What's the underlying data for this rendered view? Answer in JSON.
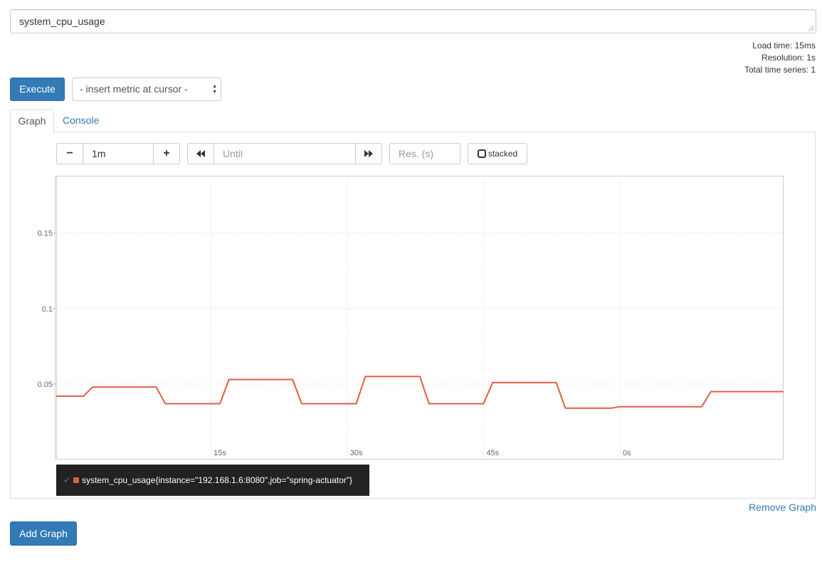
{
  "expression": {
    "value": "system_cpu_usage"
  },
  "stats": {
    "load_time": "Load time: 15ms",
    "resolution": "Resolution: 1s",
    "total_series": "Total time series: 1"
  },
  "toolbar": {
    "execute_label": "Execute",
    "metric_select": "- insert metric at cursor -"
  },
  "tabs": [
    {
      "label": "Graph",
      "active": true
    },
    {
      "label": "Console",
      "active": false
    }
  ],
  "graph_controls": {
    "range_minus": "−",
    "range_value": "1m",
    "range_plus": "+",
    "back_icon": "double-left-arrow-icon",
    "until_placeholder": "Until",
    "forward_icon": "double-right-arrow-icon",
    "resolution_placeholder": "Res. (s)",
    "stacked_label": "stacked"
  },
  "chart_data": {
    "type": "line",
    "ylim": [
      0.0,
      0.188
    ],
    "y_ticks": [
      {
        "value": 0.05,
        "label": "0.05"
      },
      {
        "value": 0.1,
        "label": "0.1"
      },
      {
        "value": 0.15,
        "label": "0.15"
      }
    ],
    "x_range": [
      -62,
      18
    ],
    "x_ticks": [
      {
        "value": -45,
        "label": "15s"
      },
      {
        "value": -30,
        "label": "30s"
      },
      {
        "value": -15,
        "label": "45s"
      },
      {
        "value": 0,
        "label": "0s"
      }
    ],
    "grid": true,
    "series": [
      {
        "name": "system_cpu_usage{instance=\"192.168.1.6:8080\",job=\"spring-actuator\"}",
        "color": "#e05d44",
        "x": [
          -62,
          -60,
          -59,
          -58,
          -55,
          -54,
          -51,
          -50,
          -47,
          -46,
          -44,
          -43,
          -40,
          -39,
          -36,
          -35,
          -33,
          -32,
          -29,
          -28,
          -26,
          -25,
          -22,
          -21,
          -19,
          -18,
          -15,
          -14,
          -11,
          -10,
          -7,
          -6,
          -5,
          -4,
          -1,
          0,
          4,
          5,
          9,
          10,
          16,
          18
        ],
        "y": [
          0.042,
          0.042,
          0.042,
          0.048,
          0.048,
          0.048,
          0.048,
          0.037,
          0.037,
          0.037,
          0.037,
          0.053,
          0.053,
          0.053,
          0.053,
          0.037,
          0.037,
          0.037,
          0.037,
          0.055,
          0.055,
          0.055,
          0.055,
          0.037,
          0.037,
          0.037,
          0.037,
          0.051,
          0.051,
          0.051,
          0.051,
          0.034,
          0.034,
          0.034,
          0.034,
          0.035,
          0.035,
          0.035,
          0.035,
          0.045,
          0.045,
          0.045
        ]
      }
    ]
  },
  "legend": {
    "check_icon": "check-icon",
    "label": "system_cpu_usage{instance=\"192.168.1.6:8080\",job=\"spring-actuator\"}"
  },
  "remove_graph_label": "Remove Graph",
  "add_graph_label": "Add Graph"
}
